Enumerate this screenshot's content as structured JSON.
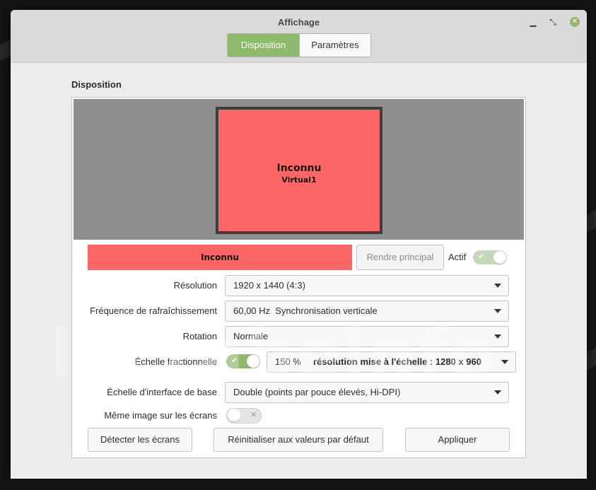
{
  "window": {
    "title": "Affichage"
  },
  "tabs": [
    {
      "label": "Disposition"
    },
    {
      "label": "Paramètres"
    }
  ],
  "section": {
    "title": "Disposition"
  },
  "preview": {
    "monitor_name": "Inconnu",
    "monitor_id": "Virtual1"
  },
  "display": {
    "selected_label": "Inconnu",
    "make_primary_label": "Rendre principal",
    "active_label": "Actif",
    "active_on": true
  },
  "settings": {
    "resolution": {
      "label": "Résolution",
      "value": "1920 x 1440 (4:3)"
    },
    "refresh": {
      "label": "Fréquence de rafraîchissement",
      "value": "60,00 Hz  Synchronisation verticale"
    },
    "rotation": {
      "label": "Rotation",
      "value": "Normale"
    },
    "fractional": {
      "label": "Échelle fractionnelle",
      "enabled": true,
      "percent": "150 %",
      "scaled_resolution": "résolution mise à l'échelle : 1280 x 960"
    },
    "base_scale": {
      "label": "Échelle d'interface de base",
      "value": "Double (points par pouce élevés, Hi-DPI)"
    },
    "mirror": {
      "label": "Même image sur les écrans",
      "enabled": false
    }
  },
  "buttons": {
    "detect": "Détecter les écrans",
    "reset": "Réinitialiser aux valeurs par défaut",
    "apply": "Appliquer"
  },
  "watermark": "lecrabeinfo",
  "icons": {
    "minimize": "minimize-icon",
    "maximize": "maximize-icon",
    "close": "close-icon",
    "check": "check-icon",
    "cross": "cross-icon",
    "dropdown": "chevron-down-icon"
  },
  "colors": {
    "accent": "#8fb96a",
    "monitor": "#ff6665",
    "preview_bg": "#8f8f8f"
  }
}
